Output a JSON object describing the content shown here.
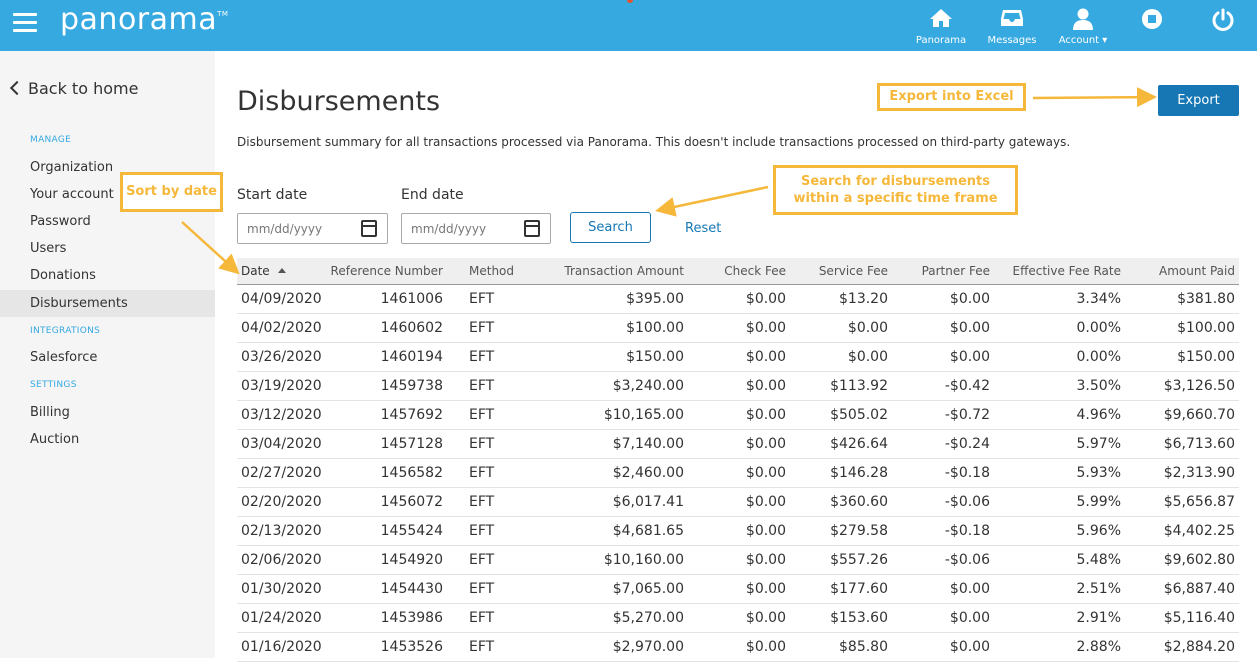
{
  "topbar": {
    "logo": "panorama",
    "trademark": "TM",
    "nav": [
      {
        "label": "Panorama",
        "icon": "home-icon"
      },
      {
        "label": "Messages",
        "icon": "inbox-icon"
      },
      {
        "label": "Account ▾",
        "icon": "user-icon"
      },
      {
        "label": "",
        "icon": "stop-icon"
      },
      {
        "label": "",
        "icon": "power-icon"
      }
    ],
    "bar_color": "#36a9e1"
  },
  "sidebar": {
    "back_label": "Back to home",
    "sections": {
      "manage": "MANAGE",
      "integrations": "INTEGRATIONS",
      "settings": "SETTINGS"
    },
    "links": {
      "organization": "Organization",
      "your_account": "Your account",
      "password": "Password",
      "users": "Users",
      "donations": "Donations",
      "disbursements": "Disbursements",
      "salesforce": "Salesforce",
      "billing": "Billing",
      "auction": "Auction"
    },
    "active": "Disbursements"
  },
  "main": {
    "title": "Disbursements",
    "description": "Disbursement summary for all transactions processed via Panorama. This doesn't include transactions processed on third-party gateways.",
    "export_label": "Export",
    "start_date_label": "Start date",
    "end_date_label": "End date",
    "start_placeholder": "mm/dd/yyyy",
    "end_placeholder": "mm/dd/yyyy",
    "search_label": "Search",
    "reset_label": "Reset"
  },
  "table": {
    "columns": [
      "Date",
      "Reference Number",
      "Method",
      "Transaction Amount",
      "Check Fee",
      "Service Fee",
      "Partner Fee",
      "Effective Fee Rate",
      "Amount Paid"
    ],
    "sort_column": "Date",
    "rows": [
      [
        "04/09/2020",
        "1461006",
        "EFT",
        "$395.00",
        "$0.00",
        "$13.20",
        "$0.00",
        "3.34%",
        "$381.80"
      ],
      [
        "04/02/2020",
        "1460602",
        "EFT",
        "$100.00",
        "$0.00",
        "$0.00",
        "$0.00",
        "0.00%",
        "$100.00"
      ],
      [
        "03/26/2020",
        "1460194",
        "EFT",
        "$150.00",
        "$0.00",
        "$0.00",
        "$0.00",
        "0.00%",
        "$150.00"
      ],
      [
        "03/19/2020",
        "1459738",
        "EFT",
        "$3,240.00",
        "$0.00",
        "$113.92",
        "-$0.42",
        "3.50%",
        "$3,126.50"
      ],
      [
        "03/12/2020",
        "1457692",
        "EFT",
        "$10,165.00",
        "$0.00",
        "$505.02",
        "-$0.72",
        "4.96%",
        "$9,660.70"
      ],
      [
        "03/04/2020",
        "1457128",
        "EFT",
        "$7,140.00",
        "$0.00",
        "$426.64",
        "-$0.24",
        "5.97%",
        "$6,713.60"
      ],
      [
        "02/27/2020",
        "1456582",
        "EFT",
        "$2,460.00",
        "$0.00",
        "$146.28",
        "-$0.18",
        "5.93%",
        "$2,313.90"
      ],
      [
        "02/20/2020",
        "1456072",
        "EFT",
        "$6,017.41",
        "$0.00",
        "$360.60",
        "-$0.06",
        "5.99%",
        "$5,656.87"
      ],
      [
        "02/13/2020",
        "1455424",
        "EFT",
        "$4,681.65",
        "$0.00",
        "$279.58",
        "-$0.18",
        "5.96%",
        "$4,402.25"
      ],
      [
        "02/06/2020",
        "1454920",
        "EFT",
        "$10,160.00",
        "$0.00",
        "$557.26",
        "-$0.06",
        "5.48%",
        "$9,602.80"
      ],
      [
        "01/30/2020",
        "1454430",
        "EFT",
        "$7,065.00",
        "$0.00",
        "$177.60",
        "$0.00",
        "2.51%",
        "$6,887.40"
      ],
      [
        "01/24/2020",
        "1453986",
        "EFT",
        "$5,270.00",
        "$0.00",
        "$153.60",
        "$0.00",
        "2.91%",
        "$5,116.40"
      ],
      [
        "01/16/2020",
        "1453526",
        "EFT",
        "$2,970.00",
        "$0.00",
        "$85.80",
        "$0.00",
        "2.88%",
        "$2,884.20"
      ]
    ]
  },
  "annotations": {
    "export": "Export into Excel",
    "sort": "Sort by date",
    "search_line1": "Search for disbursements",
    "search_line2": "within a specific time frame",
    "color": "#f5b83b"
  }
}
